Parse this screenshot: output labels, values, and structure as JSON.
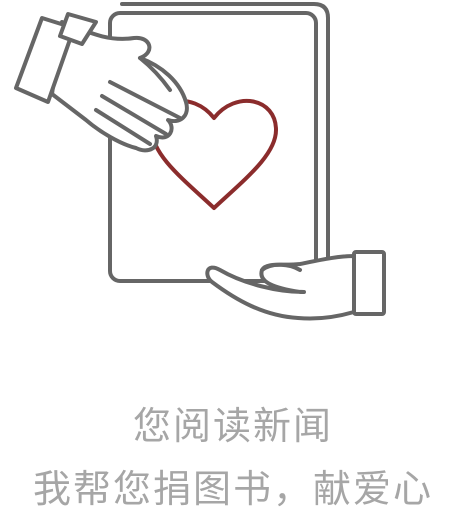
{
  "caption": {
    "line1": "您阅读新闻",
    "line2": "我帮您捐图书，献爱心"
  },
  "icons": {
    "main": "donate-book-icon",
    "heart": "heart-icon",
    "giving_hand": "giving-hand-icon",
    "receiving_hand": "receiving-hand-icon"
  },
  "colors": {
    "outline": "#666666",
    "heart": "#8b2c2c",
    "caption_text": "#a6a6a6",
    "background": "#ffffff"
  }
}
